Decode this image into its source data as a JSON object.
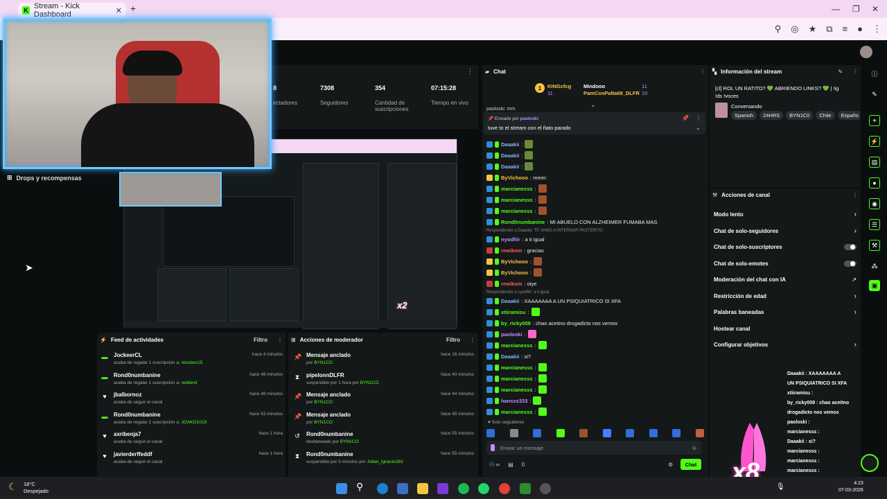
{
  "browser": {
    "tab_title": "Stream - Kick Dashboard",
    "tab_close": "✕",
    "new_tab": "+",
    "window_controls": [
      "—",
      "❐",
      "✕"
    ]
  },
  "sidebar": {
    "drops_label": "Drops y recompensas"
  },
  "stats": [
    {
      "value": "8",
      "label": "ectadores"
    },
    {
      "value": "7308",
      "label": "Seguidores"
    },
    {
      "value": "354",
      "label": "Cantidad de suscripciones"
    },
    {
      "value": "07:15:28",
      "label": "Tiempo en vivo"
    }
  ],
  "activity_feed": {
    "title": "Feed de actividades",
    "filter": "Filtro",
    "rows": [
      {
        "icon": "gift-icon",
        "name": "JockeerCL",
        "sub": "acaba de regalar 1 suscripción a:",
        "target": "nicolaxx15",
        "time": "hace 4 minutos"
      },
      {
        "icon": "gift-icon",
        "name": "Rond0numbanine",
        "sub": "acaba de regalar 1 suscripción a:",
        "target": "reddevil",
        "time": "hace 48 minutos"
      },
      {
        "icon": "heart-icon",
        "name": "jbalbornoz",
        "sub": "acaba de seguir el canal",
        "target": "",
        "time": "hace 48 minutos"
      },
      {
        "icon": "gift-icon",
        "name": "Rond0numbanine",
        "sub": "acaba de regalar 1 suscripción a:",
        "target": "JOAKO1019",
        "time": "hace 53 minutos"
      },
      {
        "icon": "heart-icon",
        "name": "axribenja7",
        "sub": "acaba de seguir el canal",
        "target": "",
        "time": "hace 1 hora"
      },
      {
        "icon": "heart-icon",
        "name": "javierderffeddf",
        "sub": "acaba de seguir el canal",
        "target": "",
        "time": "hace 1 hora"
      }
    ]
  },
  "mod_actions": {
    "title": "Acciones de moderador",
    "filter": "Filtro",
    "rows": [
      {
        "icon": "pin-icon",
        "name": "Mensaje anclado",
        "sub": "por",
        "target": "BYN1CO",
        "time": "hace 16 minutos"
      },
      {
        "icon": "hourglass-icon",
        "name": "pipelonnDLFR",
        "sub": "suspendido por 1 hora por",
        "target": "BYN1CO",
        "time": "hace 40 minutos"
      },
      {
        "icon": "pin-icon",
        "name": "Mensaje anclado",
        "sub": "por",
        "target": "BYN1CO",
        "time": "hace 44 minutos"
      },
      {
        "icon": "pin-icon",
        "name": "Mensaje anclado",
        "sub": "por",
        "target": "BYN1CO",
        "time": "hace 45 minutos"
      },
      {
        "icon": "undo-icon",
        "name": "Rond0numbanine",
        "sub": "desbaneado por",
        "target": "BYN1CO",
        "time": "hace 55 minutos"
      },
      {
        "icon": "hourglass-icon",
        "name": "Rond0numbanine",
        "sub": "suspendido por 5 minutos por",
        "target": "Julian_ignacio283",
        "time": "hace 55 minutos"
      }
    ]
  },
  "chat": {
    "title": "Chat",
    "top_gifters": [
      {
        "name": "KINGcfcg",
        "count": "11"
      },
      {
        "name": "Mindooo",
        "count": "11"
      },
      {
        "name": "PamConPalta69_DLFR",
        "count": "10"
      }
    ],
    "cut_line": "paoloski: mm",
    "pinned_by_prefix": "Enviado por",
    "pinned_by": "paoloski",
    "pinned_message": "tuve to el stream con el ñato parado",
    "messages": [
      {
        "user": "Daaakii",
        "cls": "u-blue",
        "text": ":",
        "emote": "#6a8a3a"
      },
      {
        "user": "Daaakii",
        "cls": "u-blue",
        "text": ":",
        "emote": "#6a8a3a"
      },
      {
        "user": "Daaakii",
        "cls": "u-blue",
        "text": ":",
        "emote": "#6a8a3a"
      },
      {
        "user": "ByVichooo",
        "cls": "u-yellow",
        "text": ": mmm",
        "emote": ""
      },
      {
        "user": "marcianesss",
        "cls": "u-green",
        "text": ":",
        "emote": "#a0522d"
      },
      {
        "user": "marcianesss",
        "cls": "u-green",
        "text": ":",
        "emote": "#a0522d"
      },
      {
        "user": "marcianesss",
        "cls": "u-green",
        "text": ":",
        "emote": "#a0522d"
      },
      {
        "user": "Rond0numbanine",
        "cls": "u-green",
        "text": ": MI ABUELO CON ALZHEIMER FUMABA MAS",
        "emote": ""
      },
      {
        "user": "nyodfiir",
        "cls": "u-purple",
        "text": ": a ti igual",
        "emote": "",
        "reply": "Respondiendo a Daaakii: TE VAMO A INTERNAR PASTERITO"
      },
      {
        "user": "rewikom",
        "cls": "u-red",
        "text": ": gracias",
        "emote": ""
      },
      {
        "user": "ByVichooo",
        "cls": "u-yellow",
        "text": ":",
        "emote": "#a0522d"
      },
      {
        "user": "ByVichooo",
        "cls": "u-yellow",
        "text": ":",
        "emote": "#a0522d"
      },
      {
        "user": "rewikom",
        "cls": "u-red",
        "text": ": oiye",
        "emote": ""
      },
      {
        "user": "Daaakii",
        "cls": "u-blue",
        "text": ": XAAAAAAA A UN PSIQUIATRICO SI XFA",
        "emote": "",
        "reply": "Respondiendo a nyodfiir: a ti igual"
      },
      {
        "user": "xtiiramisu",
        "cls": "u-green",
        "text": ":",
        "emote": "#53fc18"
      },
      {
        "user": "by_ricky008",
        "cls": "u-green",
        "text": ": chao aceitno drogadicto nos vemos",
        "emote": ""
      },
      {
        "user": "paoloski",
        "cls": "u-purple",
        "text": ":",
        "emote": "#ff66cc"
      },
      {
        "user": "marcianesss",
        "cls": "u-green",
        "text": ":",
        "emote": "#53fc18"
      },
      {
        "user": "Daaakii",
        "cls": "u-blue",
        "text": ": si?",
        "emote": ""
      },
      {
        "user": "marcianesss",
        "cls": "u-green",
        "text": ":",
        "emote": "#53fc18"
      },
      {
        "user": "marcianesss",
        "cls": "u-green",
        "text": ":",
        "emote": "#53fc18"
      },
      {
        "user": "marcianesss",
        "cls": "u-green",
        "text": ":",
        "emote": "#53fc18"
      },
      {
        "user": "hansss333",
        "cls": "u-purple",
        "text": ":",
        "emote": "#53fc18"
      },
      {
        "user": "marcianesss",
        "cls": "u-green",
        "text": ":",
        "emote": "#53fc18"
      }
    ],
    "mode_notice": "Solo seguidores",
    "input_placeholder": "Enviar un mensaje",
    "count": "0",
    "send_label": "Chat"
  },
  "stream_info": {
    "title": "Información del stream",
    "stream_title": "[cl] ROL UN RATITO? 💚 ABRIENDO LINKS? 💚 | !ig !ds !voces",
    "category": "Conversando",
    "tags": [
      "Spanish",
      "24HRS",
      "BYN1C0",
      "Chile",
      "Españo"
    ]
  },
  "channel_actions": {
    "title": "Acciones de canal",
    "items": [
      {
        "label": "Modo lento",
        "control": "chevron"
      },
      {
        "label": "Chat de solo-seguidores",
        "control": "chevron"
      },
      {
        "label": "Chat de solo-suscriptores",
        "control": "toggle"
      },
      {
        "label": "Chat de solo-emotes",
        "control": "toggle"
      },
      {
        "label": "Moderación del chat con IA",
        "control": "external"
      },
      {
        "label": "Restricción de edad",
        "control": "chevron"
      },
      {
        "label": "Palabras baneadas",
        "control": "chevron"
      },
      {
        "label": "Hostear canal",
        "control": "none"
      },
      {
        "label": "Configurar objetivos",
        "control": "chevron"
      }
    ]
  },
  "overlay_chat": [
    "Daaakii : XAAAAAAA A",
    "UN PSIQUIATRICO SI XFA",
    "xtiiramisu :",
    "by_ricky008 : chao aceitno",
    "drogadicto nos vemos",
    "paoloski :",
    "marcianesss :",
    "Daaakii : si?",
    "marcianesss :",
    "marcianesss :",
    "marcianesss :",
    "hansss333 :",
    "marcianesss :"
  ],
  "overlay_multiplier": "x8",
  "preview_multiplier": "x2",
  "taskbar": {
    "weather_temp": "18°C",
    "weather_desc": "Despejado",
    "time": "4:23",
    "date": "07-03-2026"
  },
  "colors": {
    "kick_green": "#53fc18",
    "panel_bg": "#141819",
    "page_bg": "#0b0e0f"
  }
}
